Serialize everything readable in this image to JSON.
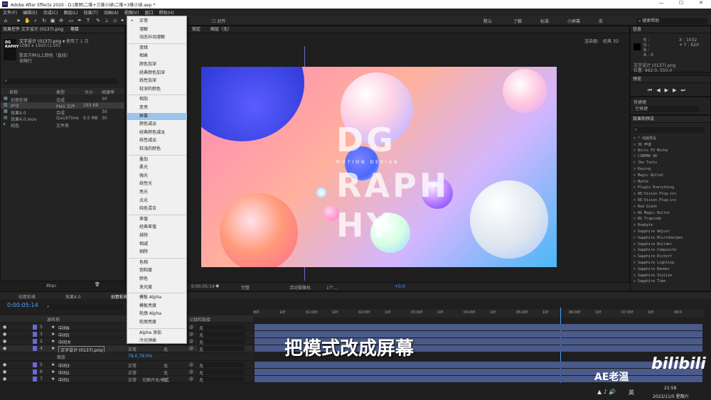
{
  "window": {
    "title": "Adobe After Effects 2020 - D:\\案例\\二维+三维小球\\二维+3维小球.aep *"
  },
  "menu": [
    "文件(F)",
    "编辑(E)",
    "合成(C)",
    "图层(L)",
    "效果(T)",
    "动画(A)",
    "视图(V)",
    "窗口",
    "帮助(H)"
  ],
  "toolbar": {
    "align_label": "对齐",
    "workspaces": [
      "默认",
      "了解",
      "标准",
      "小屏幕",
      "库"
    ],
    "search_placeholder": "搜索帮助"
  },
  "project": {
    "tab_effects": "效果控件 文字设计 (0137).png",
    "tab_project": "项目",
    "file_name": "文字设计 (0137).png ▾",
    "used": ", 使用了 1 次",
    "dims": "1080 x 1920 (1.00)",
    "comment": "数百万种以上颜色（直线）",
    "interp": "非隔行",
    "thumb_text": "DG RAPHY",
    "bpc": "8bpc",
    "columns": [
      "名称",
      "类型",
      "大小",
      "帧速率"
    ],
    "items": [
      {
        "name": "创意彩排",
        "type": "合成",
        "size": "",
        "fps": "30"
      },
      {
        "name": "png",
        "type": "PNG 文件",
        "size": "293 KB",
        "fps": ""
      },
      {
        "name": "效果4.0",
        "type": "合成",
        "size": "",
        "fps": "30"
      },
      {
        "name": "效果4.0.mov",
        "type": "QuickTime",
        "size": "9.5 MB",
        "fps": "30"
      },
      {
        "name": "纯色",
        "type": "文件夹",
        "size": "",
        "fps": ""
      }
    ]
  },
  "blend_modes": [
    {
      "label": "正常",
      "sel": false,
      "dot": true
    },
    {
      "label": "溶解"
    },
    {
      "label": "动态抖动溶解"
    },
    {
      "label": "变暗"
    },
    {
      "label": "相乘"
    },
    {
      "label": "颜色加深"
    },
    {
      "label": "经典颜色加深"
    },
    {
      "label": "线性加深"
    },
    {
      "label": "较深的颜色"
    },
    {
      "label": "相加"
    },
    {
      "label": "变亮"
    },
    {
      "label": "屏幕",
      "sel": true
    },
    {
      "label": "颜色减淡"
    },
    {
      "label": "经典颜色减淡"
    },
    {
      "label": "线性减淡"
    },
    {
      "label": "较浅的颜色"
    },
    {
      "label": "叠加"
    },
    {
      "label": "柔光"
    },
    {
      "label": "强光"
    },
    {
      "label": "线性光"
    },
    {
      "label": "亮光"
    },
    {
      "label": "点光"
    },
    {
      "label": "纯色混合"
    },
    {
      "label": "差值"
    },
    {
      "label": "经典差值"
    },
    {
      "label": "排除"
    },
    {
      "label": "相减"
    },
    {
      "label": "相除"
    },
    {
      "label": "色相"
    },
    {
      "label": "饱和度"
    },
    {
      "label": "颜色"
    },
    {
      "label": "发光度"
    },
    {
      "label": "模板 Alpha"
    },
    {
      "label": "模板亮度"
    },
    {
      "label": "轮廓 Alpha"
    },
    {
      "label": "轮廓亮度"
    },
    {
      "label": "Alpha 添加"
    },
    {
      "label": "冷光预乘"
    }
  ],
  "viewer": {
    "tab1": "锁定",
    "tab2": "图层（无）",
    "renderer": "渲染器：",
    "renderer_val": "经典 3D",
    "art_text1": "DG",
    "art_text2": "RAPH",
    "art_text3": "HY",
    "art_sub": "MOTION DESIGN",
    "timecode": "0:00:05:14",
    "quality": "完整",
    "camera": "活动摄像机",
    "views": "1个...",
    "exposure": "+0.0"
  },
  "info": {
    "title": "信息",
    "r": "R :",
    "g": "G :",
    "b": "B :",
    "a": "A : 0",
    "x": "X : 1032",
    "y": "+ Y : 620",
    "layer": "文字设计 (0137).png",
    "pos": "位置: 962.0, 550.0"
  },
  "preview": {
    "title": "预览"
  },
  "shortcut": {
    "title": "快捷键",
    "value": "空格键"
  },
  "effects_panel": {
    "title": "效果和预设",
    "items": [
      "* 动画预设",
      "3D 声道",
      "Boris FX Mocha",
      "CINEMA 4D",
      "Jke Tools",
      "Keying",
      "Magic Bullet",
      "Matte",
      "Plugin Everything",
      "RE:Vision Plug-ins",
      "RE:Vision Plug-ins",
      "Red Giant",
      "RG Magic Bullet",
      "RG Trapcode",
      "Rowbyte",
      "Sapphire Adjust",
      "Sapphire Blur+Sharpen",
      "Sapphire Builder",
      "Sapphire Composite",
      "Sapphire Distort",
      "Sapphire Lighting",
      "Sapphire Render",
      "Sapphire Stylize",
      "Sapphire Time"
    ]
  },
  "timeline": {
    "tabs": [
      "创意彩排",
      "效果4.0",
      "创意彩排"
    ],
    "timecode": "0:00:05:14",
    "col_name": "源名称",
    "col_parent": "父级和链接",
    "mode_label": "正常",
    "none_label": "无",
    "rows": [
      {
        "n": "5",
        "name": "中间6"
      },
      {
        "n": "3",
        "name": "中间5"
      },
      {
        "n": "2",
        "name": "中间大"
      },
      {
        "n": "4",
        "name": "文字设计 (0137).png"
      },
      {
        "n": "5",
        "name": "中间3"
      },
      {
        "n": "6",
        "name": "中间2"
      },
      {
        "n": "7",
        "name": "中间1"
      }
    ],
    "sub_row": "缩放",
    "sub_val": "78.0,78.0%",
    "footer": "切换开关/模式",
    "ticks": [
      "00f",
      "10f",
      "01:00f",
      "10f",
      "02:00f",
      "10f",
      "03:00f",
      "10f",
      "04:00f",
      "10f",
      "05:00f",
      "10f",
      "06:00f",
      "10f",
      "07:00f",
      "10f",
      "08:0"
    ]
  },
  "subtitle": "把模式改成屏幕",
  "watermark": "AE老温",
  "bili": "bilibili",
  "taskbar": {
    "time": "21:58",
    "date": "2022/11/5 星期六",
    "lang": "英"
  }
}
